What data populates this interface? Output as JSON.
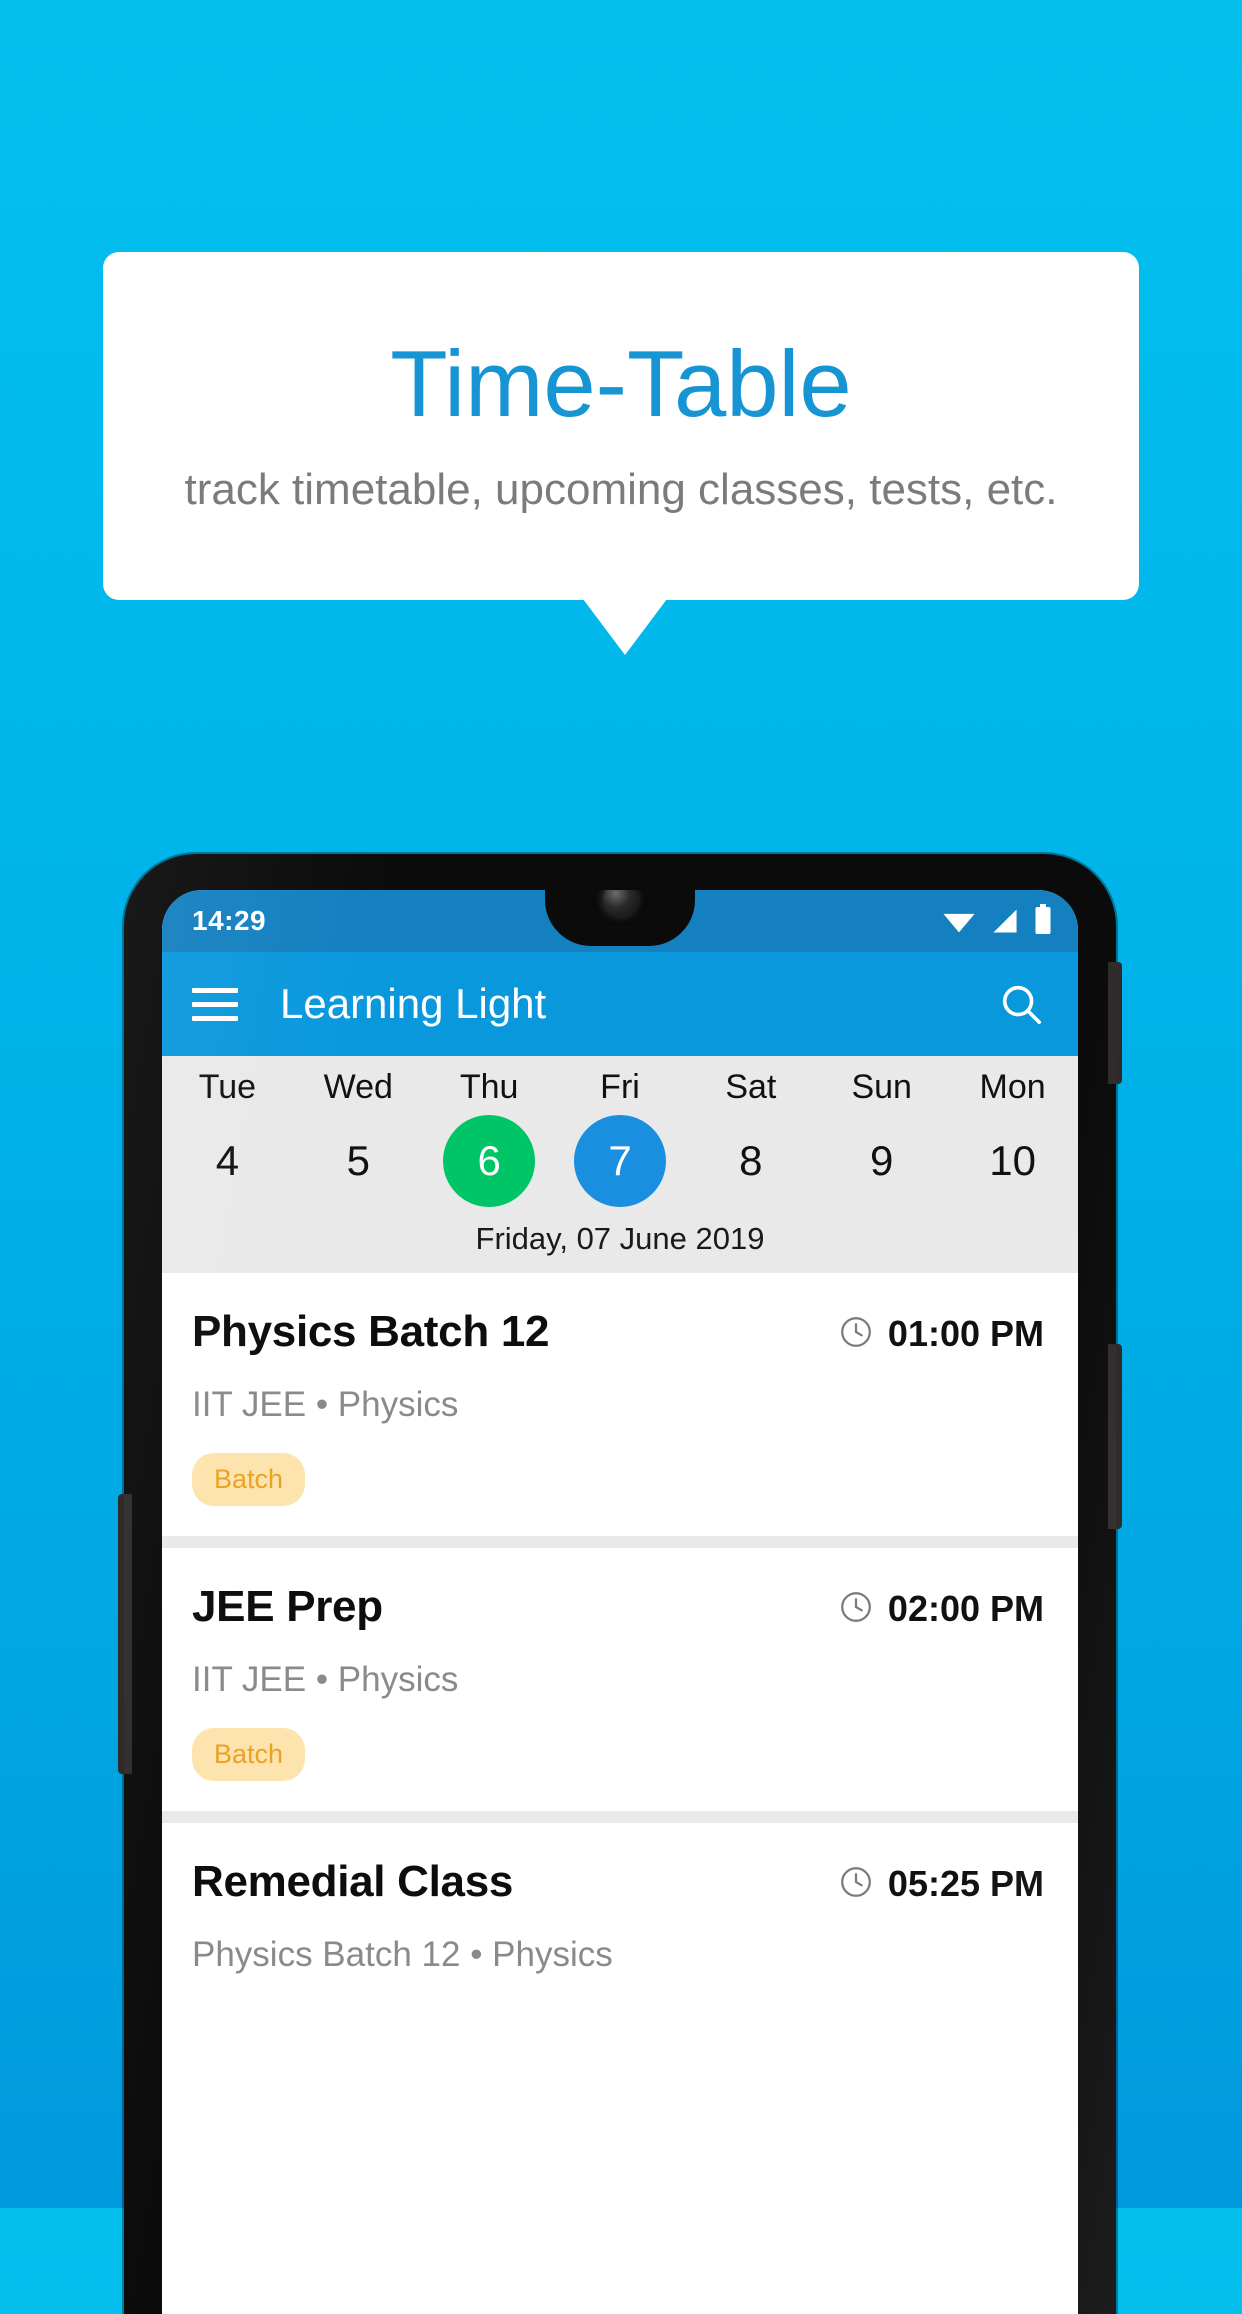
{
  "callout": {
    "title": "Time-Table",
    "subtitle": "track timetable, upcoming classes, tests, etc."
  },
  "colors": {
    "background_top": "#04c0ef",
    "background_bottom": "#0099dd",
    "title_blue": "#1794d4",
    "appbar_blue": "#0a98dd",
    "statusbar_blue": "#1480c0",
    "today_green": "#00c566",
    "selected_blue": "#1a8fe0",
    "chip_bg": "#fde4ae",
    "chip_text": "#eda124",
    "strip_gray": "#e9e9e9"
  },
  "phone": {
    "status_bar": {
      "time": "14:29",
      "icons": [
        "wifi-icon",
        "signal-icon",
        "battery-icon"
      ]
    },
    "app_bar": {
      "menu_icon": "hamburger-menu-icon",
      "title": "Learning Light",
      "search_icon": "search-icon"
    },
    "date_strip": {
      "days": [
        {
          "name": "Tue",
          "num": "4",
          "state": "normal"
        },
        {
          "name": "Wed",
          "num": "5",
          "state": "normal"
        },
        {
          "name": "Thu",
          "num": "6",
          "state": "today"
        },
        {
          "name": "Fri",
          "num": "7",
          "state": "selected"
        },
        {
          "name": "Sat",
          "num": "8",
          "state": "normal"
        },
        {
          "name": "Sun",
          "num": "9",
          "state": "normal"
        },
        {
          "name": "Mon",
          "num": "10",
          "state": "normal"
        }
      ],
      "selected_date_label": "Friday, 07 June 2019"
    },
    "classes": [
      {
        "title": "Physics Batch 12",
        "time": "01:00 PM",
        "time_icon": "clock-icon",
        "subtitle": "IIT JEE • Physics",
        "chip": "Batch"
      },
      {
        "title": "JEE Prep",
        "time": "02:00 PM",
        "time_icon": "clock-icon",
        "subtitle": "IIT JEE • Physics",
        "chip": "Batch"
      },
      {
        "title": "Remedial Class",
        "time": "05:25 PM",
        "time_icon": "clock-icon",
        "subtitle": "Physics Batch 12 • Physics",
        "chip": ""
      }
    ]
  }
}
